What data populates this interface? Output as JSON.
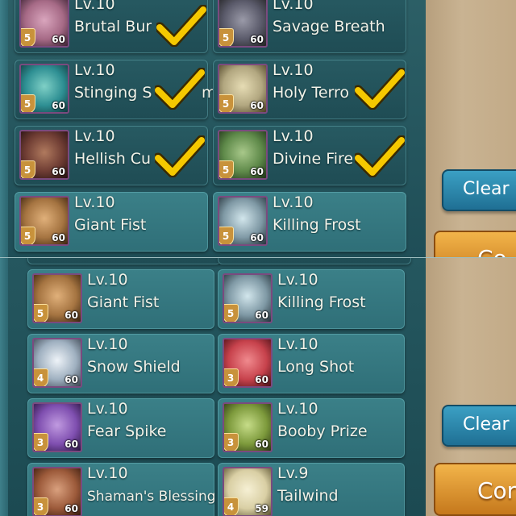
{
  "top_panel": {
    "cards": [
      {
        "level": "Lv.10",
        "name": "Brutal Bur",
        "stars": "5",
        "count": "60",
        "checked": true,
        "art": "#a66a86"
      },
      {
        "level": "Lv.10",
        "name": "Savage Breath",
        "stars": "5",
        "count": "60",
        "checked": false,
        "art": "#5a5a6a"
      },
      {
        "level": "Lv.10",
        "name": "Stinging S",
        "name_tail": "m",
        "stars": "5",
        "count": "60",
        "checked": true,
        "art": "#2e8f93"
      },
      {
        "level": "Lv.10",
        "name": "Holy Terro",
        "stars": "5",
        "count": "60",
        "checked": true,
        "art": "#b2a780"
      },
      {
        "level": "Lv.10",
        "name": "Hellish Cu",
        "stars": "5",
        "count": "60",
        "checked": true,
        "art": "#6e3c33"
      },
      {
        "level": "Lv.10",
        "name": "Divine Fire",
        "stars": "5",
        "count": "60",
        "checked": true,
        "art": "#5f8a4a"
      },
      {
        "level": "Lv.10",
        "name": "Giant Fist",
        "stars": "5",
        "count": "60",
        "checked": false,
        "art": "#a57441"
      },
      {
        "level": "Lv.10",
        "name": "Killing Frost",
        "stars": "5",
        "count": "60",
        "checked": false,
        "art": "#7f99a5"
      }
    ],
    "clear_label": "Clear S",
    "confirm_label": "Co"
  },
  "bottom_panel": {
    "cards": [
      {
        "level": "Lv.10",
        "name": "Giant Fist",
        "stars": "5",
        "count": "60",
        "art": "#a57441"
      },
      {
        "level": "Lv.10",
        "name": "Killing Frost",
        "stars": "5",
        "count": "60",
        "art": "#7f99a5"
      },
      {
        "level": "Lv.10",
        "name": "Snow Shield",
        "stars": "4",
        "count": "60",
        "art": "#9fb0c0"
      },
      {
        "level": "Lv.10",
        "name": "Long Shot",
        "stars": "3",
        "count": "60",
        "art": "#c7424c"
      },
      {
        "level": "Lv.10",
        "name": "Fear Spike",
        "stars": "3",
        "count": "60",
        "art": "#7f4fb0"
      },
      {
        "level": "Lv.10",
        "name": "Booby Prize",
        "stars": "3",
        "count": "60",
        "art": "#7d9a3c"
      },
      {
        "level": "Lv.10",
        "name": "Shaman's Blessing",
        "stars": "3",
        "count": "60",
        "art": "#9c5a3a"
      },
      {
        "level": "Lv.9",
        "name": "Tailwind",
        "stars": "4",
        "count": "59",
        "art": "#d9cfa4"
      }
    ],
    "clear_label": "Clear S",
    "confirm_label": "Cor"
  },
  "colors": {
    "check": "#f6c900",
    "frame": "#7b4a7f"
  }
}
